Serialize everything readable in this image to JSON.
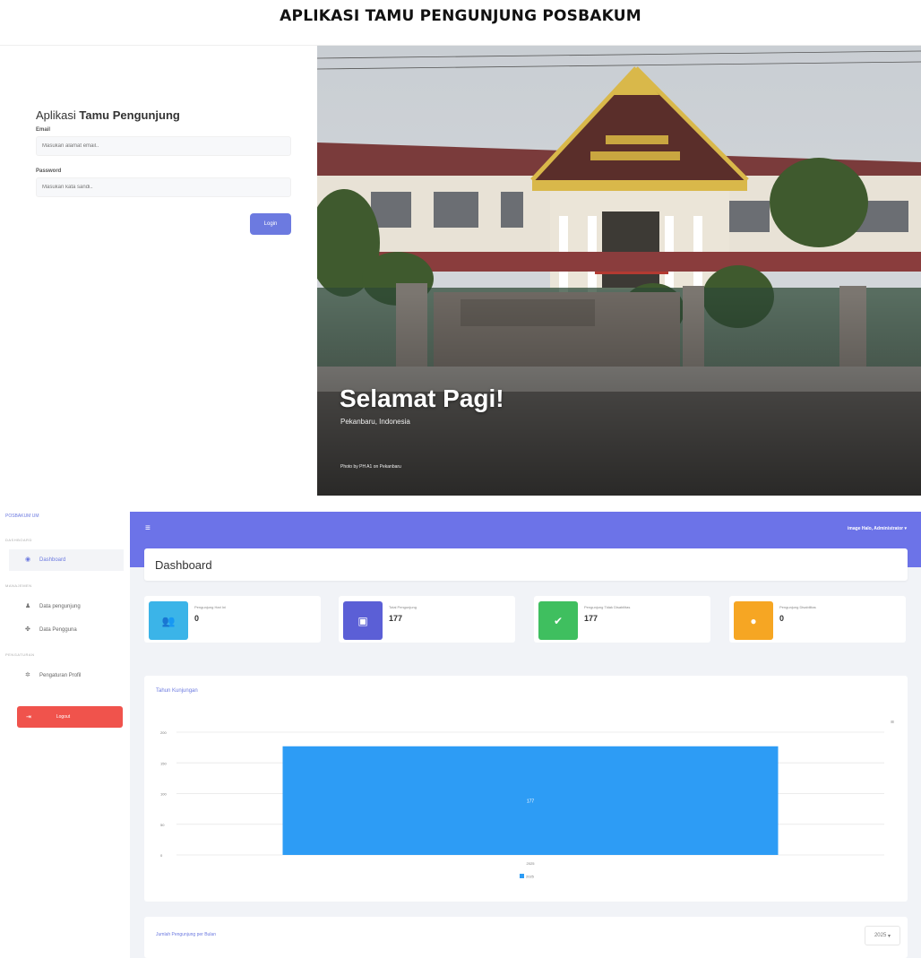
{
  "document": {
    "title": "APLIKASI TAMU PENGUNJUNG POSBAKUM"
  },
  "login": {
    "heading_prefix": "Aplikasi",
    "heading_bold": "Tamu Pengunjung",
    "email_label": "Email",
    "email_placeholder": "Masukan alamat email..",
    "password_label": "Password",
    "password_placeholder": "Masukan kata sandi..",
    "login_button": "Login",
    "greeting": "Selamat Pagi!",
    "location": "Pekanbaru, Indonesia",
    "photo_credit": "Photo by PH A1 on Pekanbaru"
  },
  "dashboard": {
    "brand": "POSBAKUM UM",
    "sections": {
      "dashboard": "DASHBOARD",
      "manajemen": "MANAJEMEN",
      "pengaturan": "PENGATURAN"
    },
    "nav": {
      "dashboard": "Dashboard",
      "data_pengunjung": "Data pengunjung",
      "data_pengguna": "Data Pengguna",
      "pengaturan_profil": "Pengaturan Profil"
    },
    "logout": "Logout",
    "user_menu": "image Halo, Administrator",
    "page_title": "Dashboard",
    "stats": [
      {
        "label": "Pengunjung Hari Ini",
        "value": "0",
        "color": "#3bb4e8",
        "icon": "users-icon"
      },
      {
        "label": "Total Pengunjung",
        "value": "177",
        "color": "#5b5fd6",
        "icon": "calendar-icon"
      },
      {
        "label": "Pengunjung Tidak Disabilitas",
        "value": "177",
        "color": "#3fbf5f",
        "icon": "check-icon"
      },
      {
        "label": "Pengunjung Disabilitas",
        "value": "0",
        "color": "#f6a623",
        "icon": "info-icon"
      }
    ],
    "chart_title": "Tahun Kunjungan",
    "month_title": "Jumlah Pengunjung per Bulan",
    "year_select": "2025"
  },
  "chart_data": {
    "type": "bar",
    "title": "Tahun Kunjungan",
    "categories": [
      "2025"
    ],
    "series": [
      {
        "name": "2025",
        "values": [
          177
        ]
      }
    ],
    "data_labels": [
      "177"
    ],
    "y_ticks": [
      "200",
      "150",
      "100",
      "50",
      "0"
    ],
    "ylim": [
      0,
      200
    ],
    "grid": true,
    "legend_position": "bottom",
    "bar_color": "#2d9cf5"
  }
}
